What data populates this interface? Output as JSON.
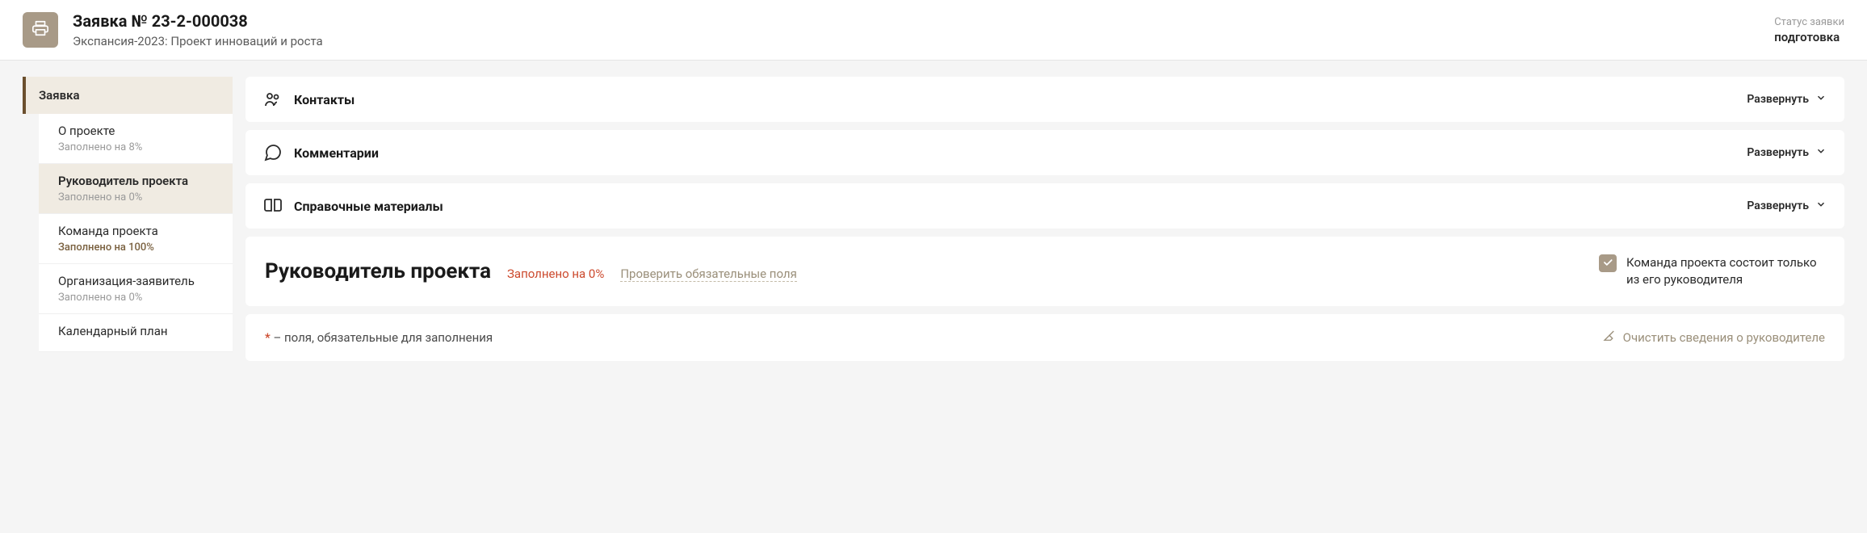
{
  "header": {
    "title": "Заявка № 23-2-000038",
    "subtitle": "Экспансия-2023: Проект инноваций и роста",
    "status_label": "Статус заявки",
    "status_value": "подготовка"
  },
  "sidebar": {
    "header": "Заявка",
    "items": [
      {
        "title": "О проекте",
        "subtitle": "Заполнено на 8%",
        "active": false,
        "complete": false
      },
      {
        "title": "Руководитель проекта",
        "subtitle": "Заполнено на 0%",
        "active": true,
        "complete": false
      },
      {
        "title": "Команда проекта",
        "subtitle": "Заполнено на 100%",
        "active": false,
        "complete": true
      },
      {
        "title": "Организация-заявитель",
        "subtitle": "Заполнено на 0%",
        "active": false,
        "complete": false
      },
      {
        "title": "Календарный план",
        "subtitle": "",
        "active": false,
        "complete": false
      }
    ]
  },
  "panels": [
    {
      "icon": "people",
      "title": "Контакты",
      "expand": "Развернуть"
    },
    {
      "icon": "chat",
      "title": "Комментарии",
      "expand": "Развернуть"
    },
    {
      "icon": "book",
      "title": "Справочные материалы",
      "expand": "Развернуть"
    }
  ],
  "section": {
    "title": "Руководитель проекта",
    "fill_text": "Заполнено на 0%",
    "check_link": "Проверить обязательные поля",
    "checkbox_label": "Команда проекта состоит только из его руководителя"
  },
  "footer": {
    "asterisk": "*",
    "required_text": " – поля, обязательные для заполнения",
    "clear_action": "Очистить сведения о руководителе"
  }
}
